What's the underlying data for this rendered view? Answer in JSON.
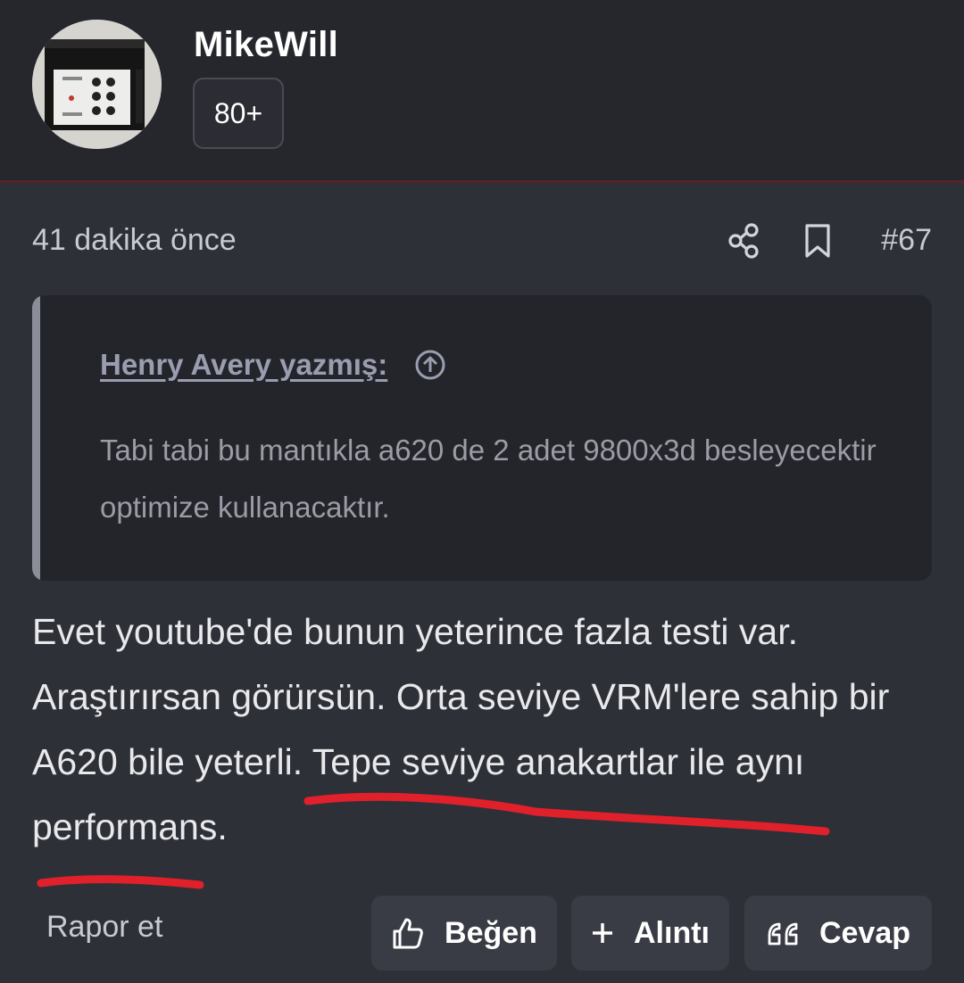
{
  "header": {
    "username": "MikeWill",
    "badge": "80+"
  },
  "post": {
    "timestamp": "41 dakika önce",
    "post_number": "#67",
    "quote": {
      "author_label": "Henry Avery yazmış:",
      "text": "Tabi tabi bu mantıkla a620 de 2 adet 9800x3d besleyecektir optimize kullanacaktır."
    },
    "body_text": "Evet youtube'de bunun yeterince fazla testi var. Araştırırsan görürsün. Orta seviye VRM'lere sahip bir A620 bile yeterli. Tepe seviye anakartlar ile aynı performans."
  },
  "actions": {
    "report": "Rapor et",
    "like": "Beğen",
    "quote": "Alıntı",
    "reply": "Cevap"
  },
  "icons": {
    "share": "share-icon",
    "bookmark": "bookmark-icon",
    "jump": "arrow-up-circle-icon",
    "like": "thumbs-up-icon",
    "quote": "plus-icon",
    "reply": "quote-marks-icon"
  },
  "colors": {
    "background": "#2e3038",
    "header": "#26272d",
    "annotation": "#e0202a",
    "button": "#3a3c45"
  }
}
